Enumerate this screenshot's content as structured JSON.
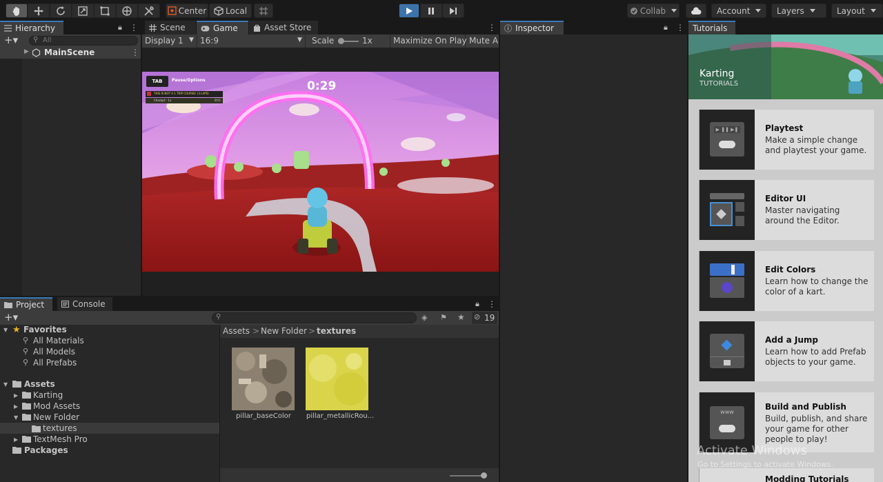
{
  "toolbar": {
    "pivot_label": "Center",
    "space_label": "Local",
    "collab_label": "Collab",
    "account_label": "Account",
    "layers_label": "Layers",
    "layout_label": "Layout"
  },
  "hierarchy": {
    "tab_label": "Hierarchy",
    "search_placeholder": "All",
    "scene_name": "MainScene"
  },
  "game_view": {
    "tabs": [
      "Scene",
      "Game",
      "Asset Store"
    ],
    "display_label": "Display 1",
    "aspect_label": "16:9",
    "scale_label": "Scale",
    "scale_value": "1x",
    "maximize_label": "Maximize On Play",
    "mute_label": "Mute Au",
    "hud_timer": "0:29",
    "hud_tab_key": "TAB",
    "hud_pause_label": "Pause/Options",
    "hud_objective": "THIS IS NOT A 1 TRIP COURSE! (3 LAPS)",
    "hud_lap_label": "Checkpt - 1x",
    "hud_lap_value": "0/11"
  },
  "inspector": {
    "tab_label": "Inspector"
  },
  "tutorials": {
    "tab_label": "Tutorials",
    "header_title": "Karting",
    "header_subtitle": "TUTORIALS",
    "cards": [
      {
        "title": "Playtest",
        "desc": "Make a simple change and playtest your game.",
        "icon": "gamepad-icon"
      },
      {
        "title": "Editor UI",
        "desc": "Master navigating around the Editor.",
        "icon": "cube-icon"
      },
      {
        "title": "Edit Colors",
        "desc": "Learn how to change the color of a kart.",
        "icon": "color-slider-icon"
      },
      {
        "title": "Add a Jump",
        "desc": "Learn how to add Prefab objects to your game.",
        "icon": "prefab-icon"
      },
      {
        "title": "Build and Publish",
        "desc": "Build, publish, and share your game for other people to play!",
        "icon": "www-icon"
      }
    ],
    "partial_card_title": "Modding Tutorials"
  },
  "watermark": {
    "line1": "Activate Windows",
    "line2": "Go to Settings to activate Windows."
  },
  "project": {
    "tabs": [
      "Project",
      "Console"
    ],
    "hidden_count": "19",
    "favorites_label": "Favorites",
    "favorites": [
      "All Materials",
      "All Models",
      "All Prefabs"
    ],
    "assets_label": "Assets",
    "folders": [
      "Karting",
      "Mod Assets",
      "New Folder"
    ],
    "subfolder": "textures",
    "textmesh_label": "TextMesh Pro",
    "packages_label": "Packages",
    "breadcrumb": [
      "Assets",
      "New Folder",
      "textures"
    ],
    "files": [
      "pillar_baseColor",
      "pillar_metallicRou..."
    ]
  },
  "colors": {
    "accent": "#3a79bb",
    "play_button": "#3c73aa",
    "panel": "#282828",
    "selection": "#2c5d87"
  }
}
